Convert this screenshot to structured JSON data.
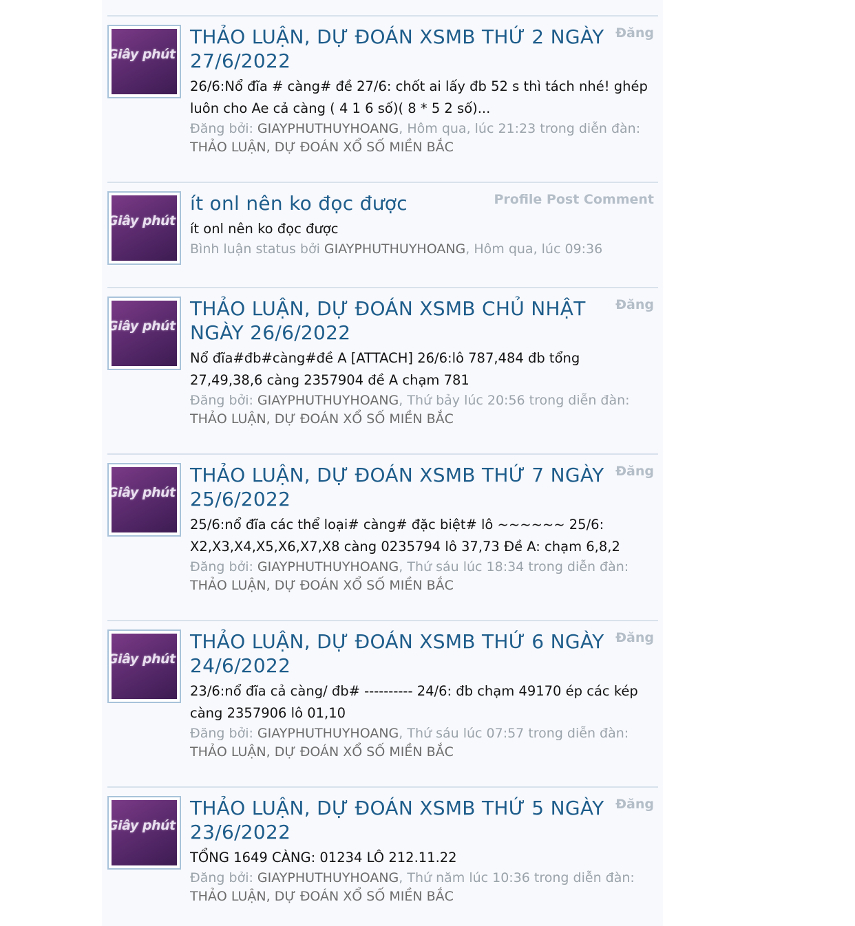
{
  "results": [
    {
      "title": "THẢO LUẬN, DỰ ĐOÁN XSMB THỨ 2 NGÀY 27/6/2022",
      "type": "Đăng",
      "snippet": "26/6:Nổ đĩa # càng# đề 27/6: chốt ai lấy đb 52 s thì tách nhé! ghép luôn cho Ae cả càng ( 4 1 6 số)( 8 * 5 2 số)...",
      "meta_prefix": "Đăng bởi: ",
      "user": "GIAYPHUTHUYHOANG",
      "meta_mid": ", Hôm qua, lúc 21:23 trong diễn đàn: ",
      "forum": "THẢO LUẬN, DỰ ĐOÁN XỔ SỐ MIỀN BẮC",
      "avatar_text": "Giây phút huy hoàng"
    },
    {
      "title": "ít onl nên ko đọc được",
      "type": "Profile Post Comment",
      "snippet": "ít onl nên ko đọc được",
      "meta_prefix": "Bình luận status bởi ",
      "user": "GIAYPHUTHUYHOANG",
      "meta_mid": ", Hôm qua, lúc 09:36",
      "forum": "",
      "avatar_text": "Giây phút huy hoàng"
    },
    {
      "title": "THẢO LUẬN, DỰ ĐOÁN XSMB CHỦ NHẬT NGÀY 26/6/2022",
      "type": "Đăng",
      "snippet": "Nổ đĩa#đb#càng#đề A [ATTACH] 26/6:lô 787,484 đb tổng 27,49,38,6 càng 2357904 đề A chạm 781",
      "meta_prefix": "Đăng bởi: ",
      "user": "GIAYPHUTHUYHOANG",
      "meta_mid": ", Thứ bảy lúc 20:56 trong diễn đàn: ",
      "forum": "THẢO LUẬN, DỰ ĐOÁN XỔ SỐ MIỀN BẮC",
      "avatar_text": "Giây phút huy hoàng"
    },
    {
      "title": "THẢO LUẬN, DỰ ĐOÁN XSMB THỨ 7 NGÀY 25/6/2022",
      "type": "Đăng",
      "snippet": "25/6:nổ đĩa các thể loại# càng# đặc biệt# lô ~~~~~~ 25/6: X2,X3,X4,X5,X6,X7,X8 càng 0235794 lô 37,73 Đề A: chạm 6,8,2",
      "meta_prefix": "Đăng bởi: ",
      "user": "GIAYPHUTHUYHOANG",
      "meta_mid": ", Thứ sáu lúc 18:34 trong diễn đàn: ",
      "forum": "THẢO LUẬN, DỰ ĐOÁN XỔ SỐ MIỀN BẮC",
      "avatar_text": "Giây phút huy hoàng"
    },
    {
      "title": "THẢO LUẬN, DỰ ĐOÁN XSMB THỨ 6 NGÀY 24/6/2022",
      "type": "Đăng",
      "snippet": "23/6:nổ đĩa cả càng/ đb# ---------- 24/6: đb chạm 49170 ép các kép càng 2357906 lô 01,10",
      "meta_prefix": "Đăng bởi: ",
      "user": "GIAYPHUTHUYHOANG",
      "meta_mid": ", Thứ sáu lúc 07:57 trong diễn đàn: ",
      "forum": "THẢO LUẬN, DỰ ĐOÁN XỔ SỐ MIỀN BẮC",
      "avatar_text": "Giây phút huy hoàng"
    },
    {
      "title": "THẢO LUẬN, DỰ ĐOÁN XSMB THỨ 5 NGÀY 23/6/2022",
      "type": "Đăng",
      "snippet": "TỔNG 1649 CÀNG: 01234 LÔ 212.11.22",
      "meta_prefix": "Đăng bởi: ",
      "user": "GIAYPHUTHUYHOANG",
      "meta_mid": ", Thứ năm lúc 10:36 trong diễn đàn: ",
      "forum": "THẢO LUẬN, DỰ ĐOÁN XỔ SỐ MIỀN BẮC",
      "avatar_text": "Giây phút huy hoàng"
    }
  ]
}
